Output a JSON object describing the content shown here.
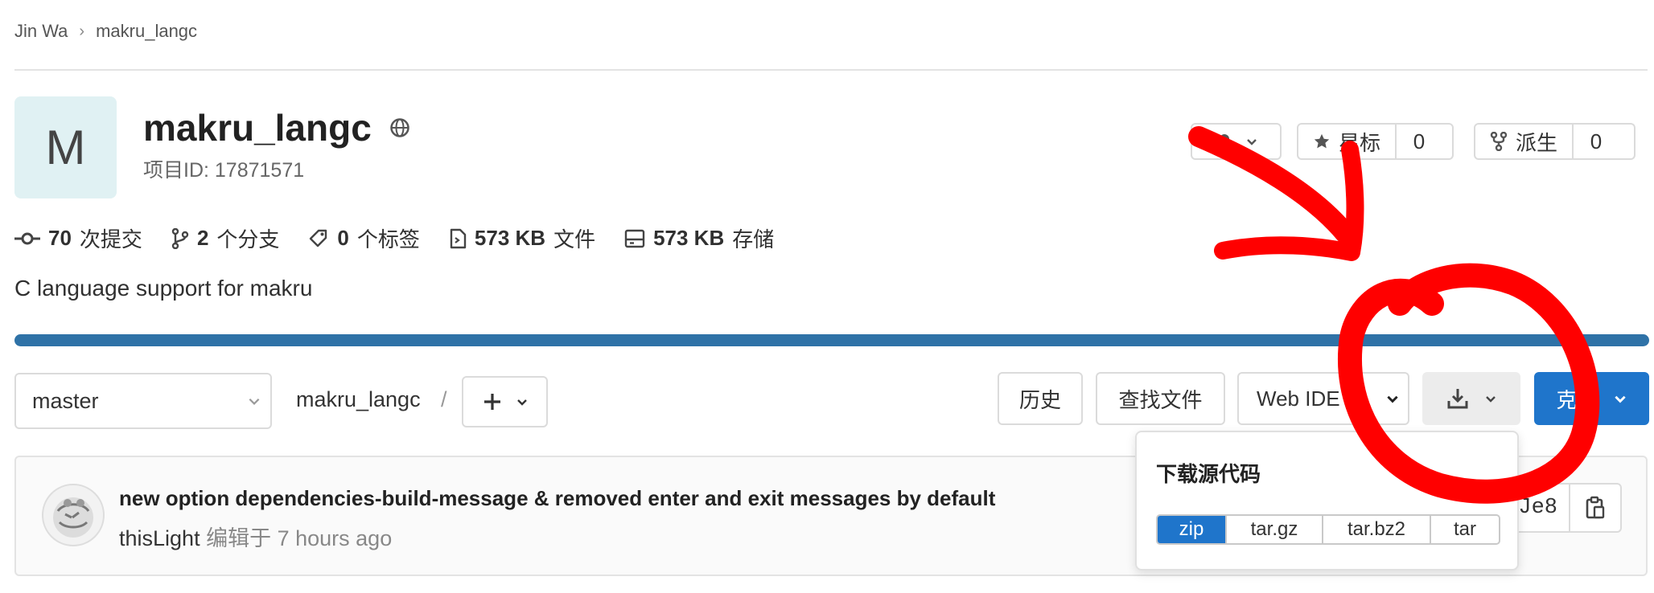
{
  "breadcrumb": {
    "owner": "Jin Wa",
    "separator": "›",
    "project": "makru_langc"
  },
  "project": {
    "avatar_letter": "M",
    "name": "makru_langc",
    "visibility_icon": "globe-icon",
    "id_label": "项目ID: 17871571"
  },
  "header_actions": {
    "notify_icon": "bell-icon",
    "star_label": "星标",
    "star_count": "0",
    "fork_label": "派生",
    "fork_count": "0"
  },
  "stats": {
    "commits_count": "70",
    "commits_label": "次提交",
    "branches_count": "2",
    "branches_label": "个分支",
    "tags_count": "0",
    "tags_label": "个标签",
    "files_size": "573 KB",
    "files_label": "文件",
    "storage_size": "573 KB",
    "storage_label": "存储"
  },
  "description": "C language support for makru",
  "progress": {
    "fraction": 1.0,
    "color": "#2f72a7"
  },
  "toolbar": {
    "branch": "master",
    "path": "makru_langc",
    "path_sep": "/",
    "history": "历史",
    "find_file": "查找文件",
    "web_ide": "Web IDE",
    "clone": "克隆"
  },
  "commit": {
    "message": "new option dependencies-build-message & removed enter and exit messages by default",
    "author": "thisLight",
    "action": "编辑于",
    "time": "7 hours ago",
    "sha_fragment": "Je8"
  },
  "download_dropdown": {
    "title": "下载源代码",
    "formats": [
      "zip",
      "tar.gz",
      "tar.bz2",
      "tar"
    ],
    "selected": "zip"
  },
  "colors": {
    "accent": "#1f75cb",
    "annotation": "#ff0000"
  }
}
